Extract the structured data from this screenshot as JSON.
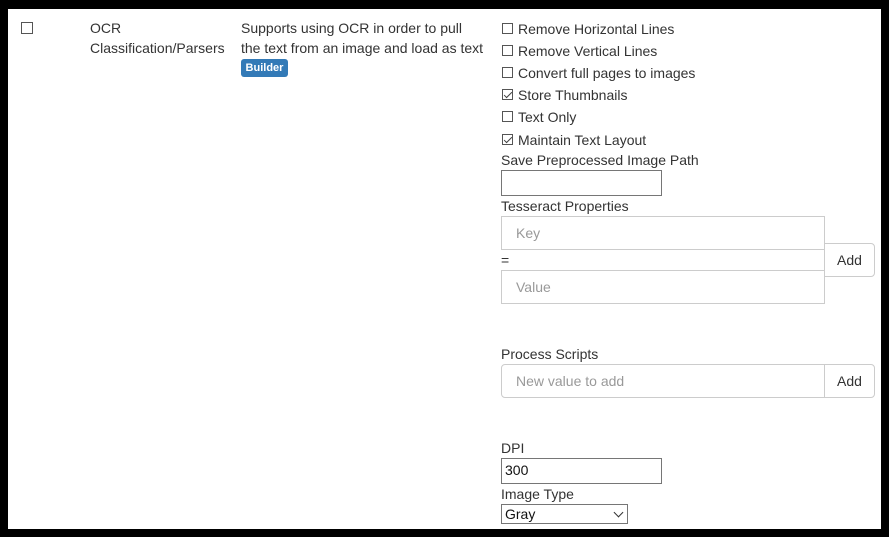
{
  "row": {
    "name_line1": "OCR",
    "name_line2": "Classification/Parsers",
    "desc_line1": "Supports using OCR in order to pull",
    "desc_line2": "the text from an image and load as text",
    "badge": "Builder"
  },
  "options": [
    {
      "label": "Remove Horizontal Lines",
      "checked": false
    },
    {
      "label": "Remove Vertical Lines",
      "checked": false
    },
    {
      "label": "Convert full pages to images",
      "checked": false
    },
    {
      "label": "Store Thumbnails",
      "checked": true
    },
    {
      "label": "Text Only",
      "checked": false
    },
    {
      "label": "Maintain Text Layout",
      "checked": true
    }
  ],
  "preprocessed": {
    "label": "Save Preprocessed Image Path",
    "value": ""
  },
  "tesseract": {
    "label": "Tesseract Properties",
    "key_placeholder": "Key",
    "equals": "=",
    "value_placeholder": "Value",
    "add_label": "Add"
  },
  "scripts": {
    "label": "Process Scripts",
    "placeholder": "New value to add",
    "add_label": "Add"
  },
  "dpi": {
    "label": "DPI",
    "value": "300"
  },
  "image_type": {
    "label": "Image Type",
    "selected": "Gray"
  }
}
